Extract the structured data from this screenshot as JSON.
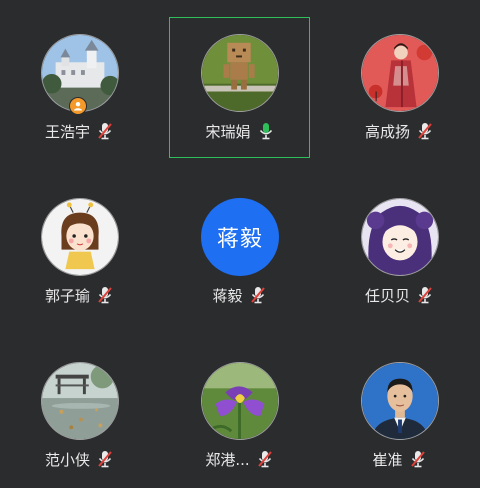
{
  "colors": {
    "background": "#2b2c2e",
    "speaking_border": "#2fbf5a",
    "muted_icon_slash": "#e0403a",
    "active_mic": "#2fbf5a",
    "initials_avatar": "#1e6ff1",
    "host_badge": "#f39a2b"
  },
  "participants": [
    {
      "name": "王浩宇",
      "mic": "muted-mic-icon",
      "avatar": "castle-photo",
      "host": true
    },
    {
      "name": "宋瑞娟",
      "mic": "active-mic-icon",
      "avatar": "cardboard-robot-photo",
      "speaking": true
    },
    {
      "name": "高成扬",
      "mic": "muted-mic-icon",
      "avatar": "girl-in-red-photo"
    },
    {
      "name": "郭子瑜",
      "mic": "muted-mic-icon",
      "avatar": "cartoon-girl-illustration"
    },
    {
      "name": "蒋毅",
      "mic": "muted-mic-icon",
      "avatar_text": "蒋毅"
    },
    {
      "name": "任贝贝",
      "mic": "muted-mic-icon",
      "avatar": "anime-girl-illustration"
    },
    {
      "name": "范小侠",
      "mic": "muted-mic-icon",
      "avatar": "rainy-park-photo"
    },
    {
      "name": "郑港...",
      "mic": "muted-mic-icon",
      "avatar": "purple-iris-photo"
    },
    {
      "name": "崔准",
      "mic": "muted-mic-icon",
      "avatar": "man-portrait-photo"
    }
  ]
}
